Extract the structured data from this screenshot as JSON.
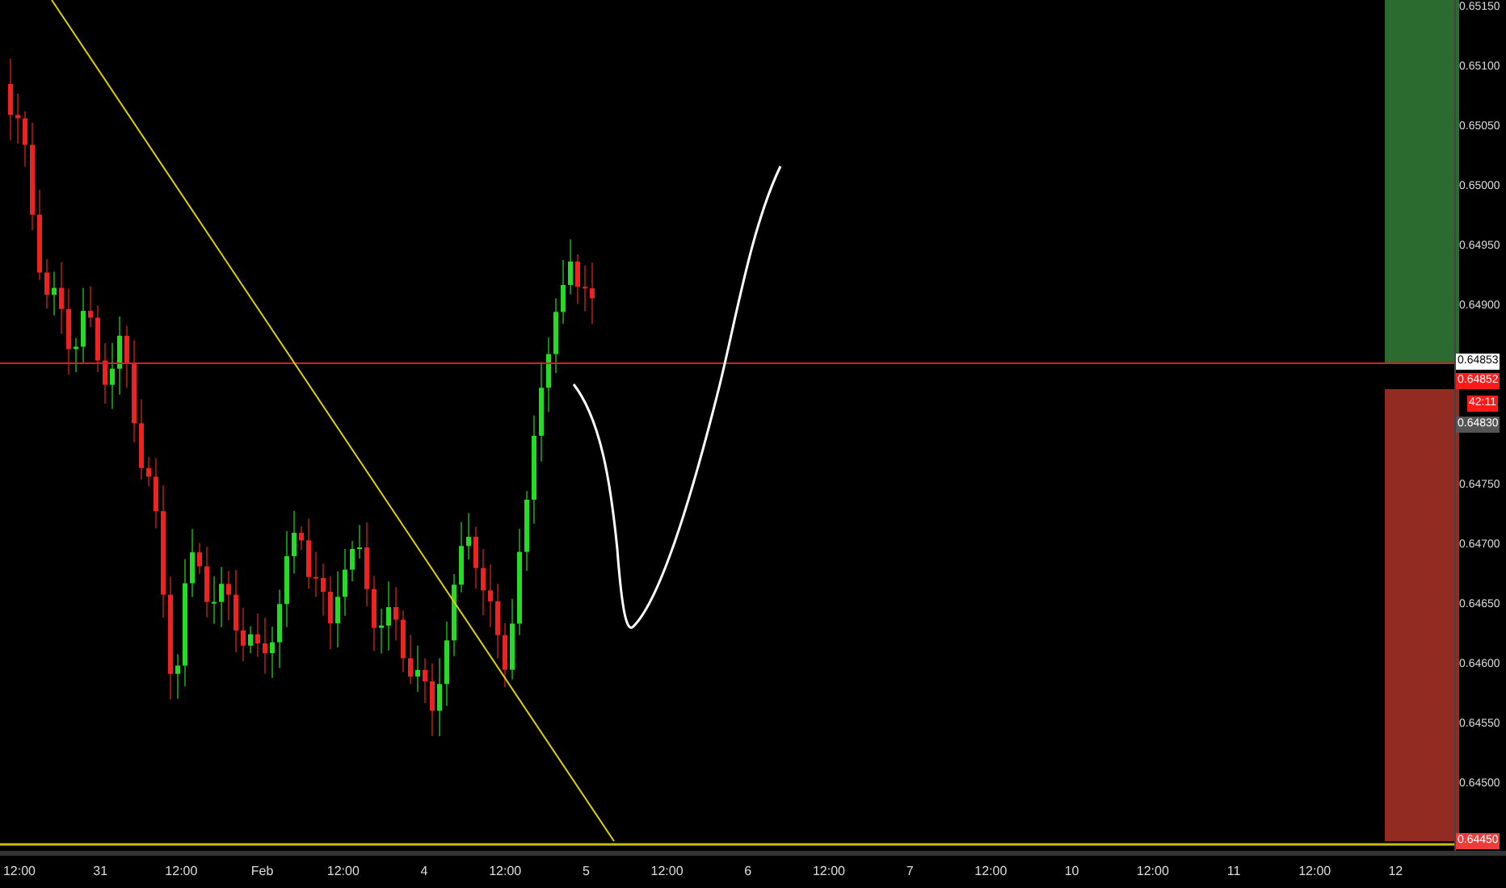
{
  "price_axis": {
    "upper_labels": [
      "0.65150",
      "0.65100",
      "0.65050",
      "0.65000",
      "0.64950",
      "0.64900"
    ],
    "lower_labels": [
      "0.64750",
      "0.64700",
      "0.64650",
      "0.64600",
      "0.64550",
      "0.64500"
    ]
  },
  "price_badges": [
    {
      "kind": "last",
      "text": "0.64853"
    },
    {
      "kind": "bid",
      "text": "0.64852"
    },
    {
      "kind": "countdown",
      "text": "42:11"
    },
    {
      "kind": "ask",
      "text": "0.64830"
    },
    {
      "kind": "stop",
      "text": "0.64450"
    }
  ],
  "time_axis": {
    "labels": [
      "12:00",
      "31",
      "12:00",
      "Feb",
      "12:00",
      "4",
      "12:00",
      "5",
      "12:00",
      "6",
      "12:00",
      "7",
      "12:00",
      "10",
      "12:00",
      "11",
      "12:00",
      "12"
    ]
  }
}
